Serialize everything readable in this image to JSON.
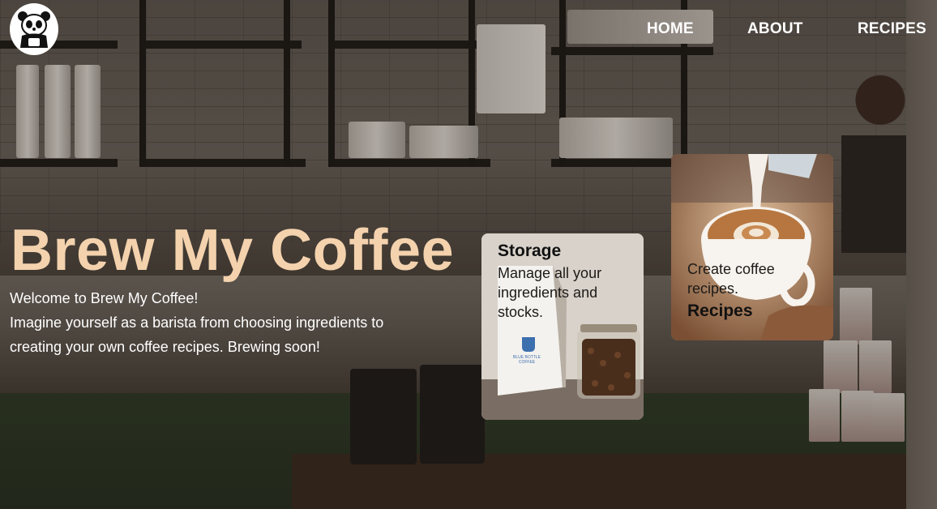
{
  "nav": {
    "logo_icon": "panda-icon",
    "items": [
      {
        "label": "HOME"
      },
      {
        "label": "ABOUT"
      },
      {
        "label": "RECIPES"
      }
    ]
  },
  "hero": {
    "title": "Brew My Coffee",
    "line1": "Welcome to Brew My Coffee!",
    "line2": "Imagine yourself as a barista from choosing ingredients to",
    "line3": "creating your own coffee recipes. Brewing soon!"
  },
  "cards": {
    "storage": {
      "title": "Storage",
      "desc_line1": "Manage all your",
      "desc_line2": "ingredients and",
      "desc_line3": "stocks.",
      "bag_text": "BLUE BOTTLE COFFEE",
      "image_icon": "coffee-bag-and-jar-icon"
    },
    "recipes": {
      "title": "Recipes",
      "desc_line1": "Create coffee",
      "desc_line2": "recipes.",
      "image_icon": "latte-art-cup-icon"
    }
  },
  "colors": {
    "title_color": "#f3d2ad",
    "nav_text": "#ffffff",
    "card_storage_bg": "#d7d1cb"
  }
}
